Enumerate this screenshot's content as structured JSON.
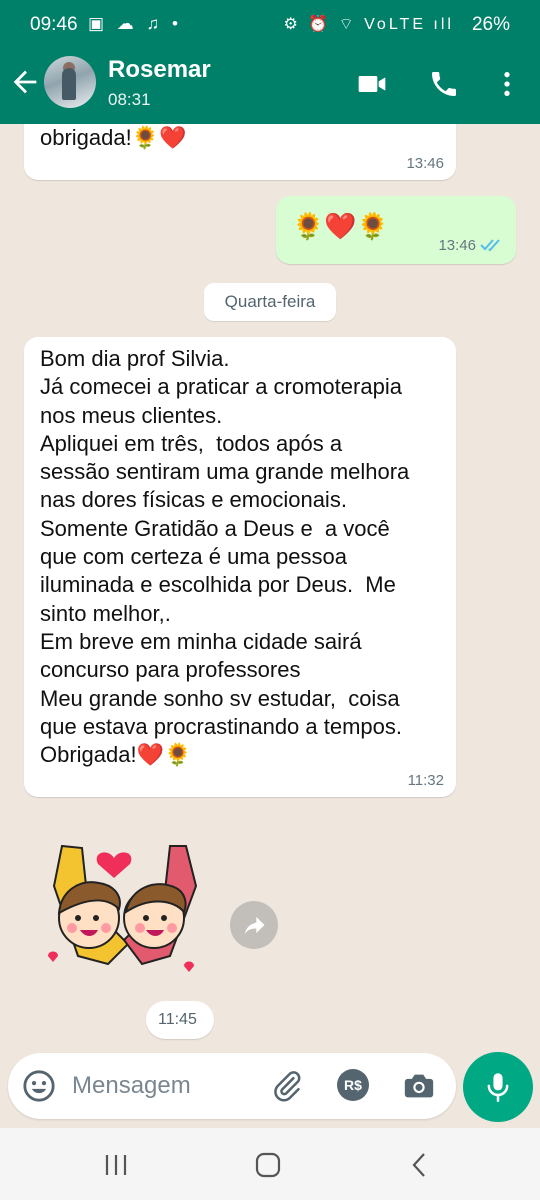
{
  "status_bar": {
    "time": "09:46",
    "left_icons": "▣ ☁ ♫ •",
    "right_icons": "⚙ ⏰ ⌔ VoLTE ıll",
    "battery": "26%"
  },
  "header": {
    "contact_name": "Rosemar",
    "subtitle": "08:31",
    "accent_color": "#008069"
  },
  "messages": [
    {
      "direction": "in",
      "text": "obrigada!🌻❤️",
      "time": "13:46"
    },
    {
      "direction": "out",
      "text": "🌻❤️🌻",
      "time": "13:46",
      "status": "read"
    },
    {
      "direction": "in",
      "text": "Bom dia prof Silvia.\nJá comecei a praticar a cromoterapia\nnos meus clientes.\nApliquei em três,  todos após a\nsessão sentiram uma grande melhora\nnas dores físicas e emocionais.\nSomente Gratidão a Deus e  a você\nque com certeza é uma pessoa\niluminada e escolhida por Deus.  Me\nsinto melhor,.\nEm breve em minha cidade sairá\nconcurso para professores\nMeu grande sonho sv estudar,  coisa\nque estava procrastinando a tempos.\nObrigada!❤️🌻",
      "time": "11:32"
    },
    {
      "direction": "in",
      "type": "sticker",
      "time": "11:45"
    }
  ],
  "date_separator": "Quarta-feira",
  "composer": {
    "placeholder": "Mensagem",
    "icons": [
      "emoji-icon",
      "attach-icon",
      "payment-icon",
      "camera-icon",
      "mic-icon"
    ],
    "payment_label": "R$"
  }
}
